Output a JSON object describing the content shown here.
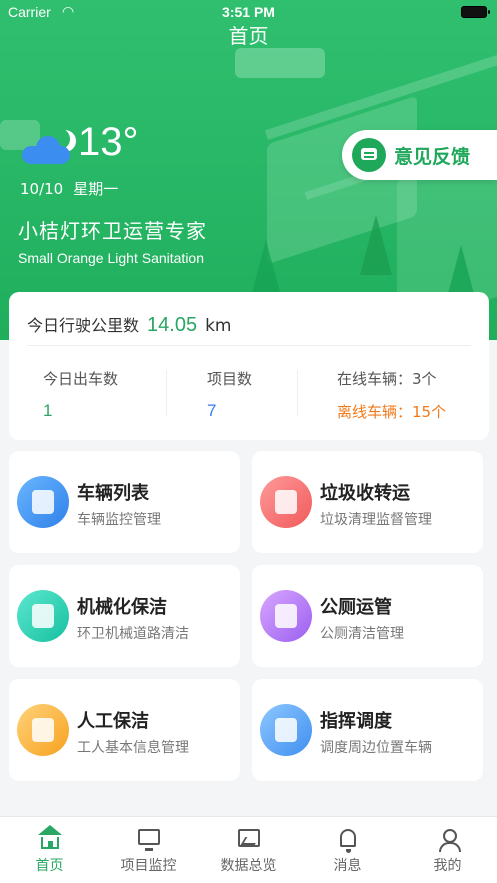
{
  "status_bar": {
    "carrier": "Carrier",
    "time": "3:51 PM",
    "wifi_icon": "wifi-icon",
    "battery_icon": "battery-icon"
  },
  "header": {
    "title": "首页"
  },
  "weather": {
    "temperature": "13°",
    "date": "10/10",
    "weekday": "星期一",
    "icon": "cloud-moon-icon"
  },
  "feedback": {
    "label": "意见反馈",
    "icon": "chat-icon"
  },
  "brand": {
    "slogan": "小桔灯环卫运营专家",
    "slogan_en": "Small Orange Light Sanitation"
  },
  "stats": {
    "mileage_label": "今日行驶公里数",
    "mileage_value": "14.05",
    "mileage_unit": "km",
    "dispatch_label": "今日出车数",
    "dispatch_value": "1",
    "projects_label": "项目数",
    "projects_value": "7",
    "online_text": "在线车辆：3个",
    "offline_text": "离线车辆：15个"
  },
  "modules": [
    {
      "title": "车辆列表",
      "subtitle": "车辆监控管理",
      "icon": "truck-icon"
    },
    {
      "title": "垃圾收转运",
      "subtitle": "垃圾清理监督管理",
      "icon": "trash-route-icon"
    },
    {
      "title": "机械化保洁",
      "subtitle": "环卫机械道路清洁",
      "icon": "sweeper-icon"
    },
    {
      "title": "公厕运管",
      "subtitle": "公厕清洁管理",
      "icon": "toilet-icon"
    },
    {
      "title": "人工保洁",
      "subtitle": "工人基本信息管理",
      "icon": "worker-icon"
    },
    {
      "title": "指挥调度",
      "subtitle": "调度周边位置车辆",
      "icon": "dispatch-screen-icon"
    }
  ],
  "tabs": [
    {
      "label": "首页",
      "icon": "home-icon",
      "active": true
    },
    {
      "label": "项目监控",
      "icon": "monitor-icon"
    },
    {
      "label": "数据总览",
      "icon": "chart-icon"
    },
    {
      "label": "消息",
      "icon": "bell-icon"
    },
    {
      "label": "我的",
      "icon": "user-icon"
    }
  ],
  "colors": {
    "primary": "#2aa764",
    "accent_blue": "#3a7cf0",
    "warning": "#f07a1a"
  }
}
